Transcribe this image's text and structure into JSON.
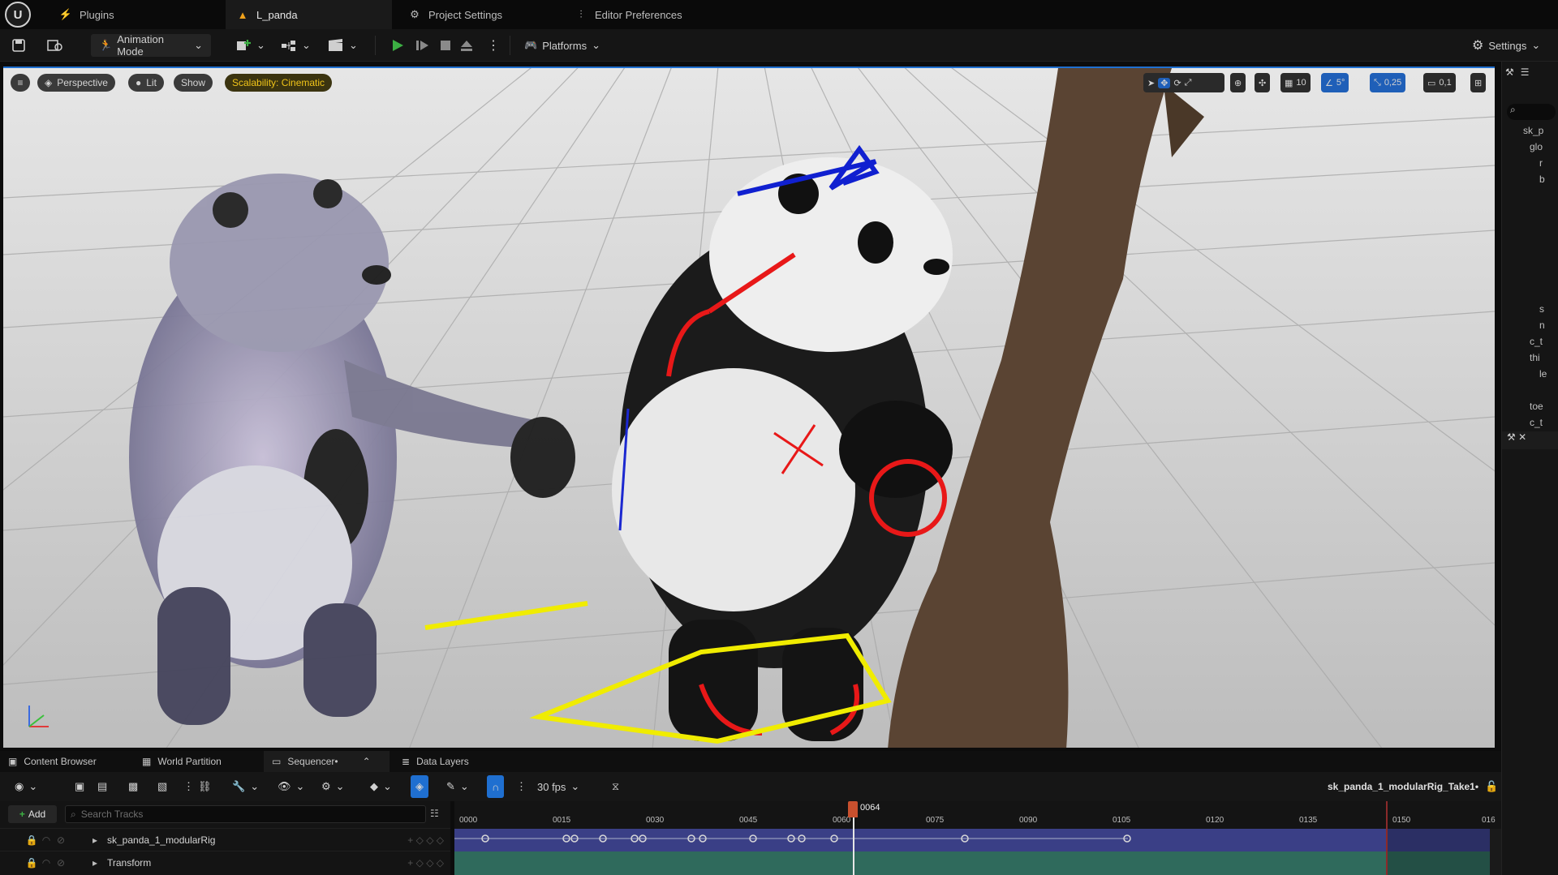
{
  "tabs": [
    {
      "label": "Plugins",
      "icon": "plug-icon"
    },
    {
      "label": "L_panda",
      "icon": "level-icon"
    },
    {
      "label": "Project Settings",
      "icon": "gear-icon"
    },
    {
      "label": "Editor Preferences",
      "icon": "sliders-icon"
    }
  ],
  "toolbar": {
    "mode_label": "Animation Mode",
    "platforms_label": "Platforms",
    "settings_label": "Settings"
  },
  "viewport": {
    "perspective_label": "Perspective",
    "lit_label": "Lit",
    "show_label": "Show",
    "scalability_label": "Scalability: Cinematic",
    "grid_snap": "10",
    "rot_snap": "5°",
    "scale_snap": "0,25",
    "camera_speed": "0,1"
  },
  "outliner": {
    "items": [
      "sk_p",
      "glo",
      "r",
      "b",
      "s",
      "n",
      "c_t",
      "thi",
      "le",
      "toe",
      "c_t"
    ]
  },
  "bottom_tabs": [
    {
      "label": "Content Browser"
    },
    {
      "label": "World Partition"
    },
    {
      "label": "Sequencer•"
    },
    {
      "label": "Data Layers"
    }
  ],
  "sequencer": {
    "fps_label": "30 fps",
    "sequence_name": "sk_panda_1_modularRig_Take1•",
    "add_label": "Add",
    "search_placeholder": "Search Tracks",
    "current_frame": "0064",
    "ticks": [
      "0000",
      "0015",
      "0030",
      "0045",
      "0060",
      "0075",
      "0090",
      "0105",
      "0120",
      "0135",
      "0150",
      "016"
    ],
    "tracks": [
      {
        "label": "sk_panda_1_modularRig"
      },
      {
        "label": "Transform"
      }
    ]
  },
  "colors": {
    "accent_blue": "#1f6fd0",
    "play_green": "#3cb043",
    "scalability_yellow": "#f0c419",
    "playhead": "#c8502e"
  }
}
